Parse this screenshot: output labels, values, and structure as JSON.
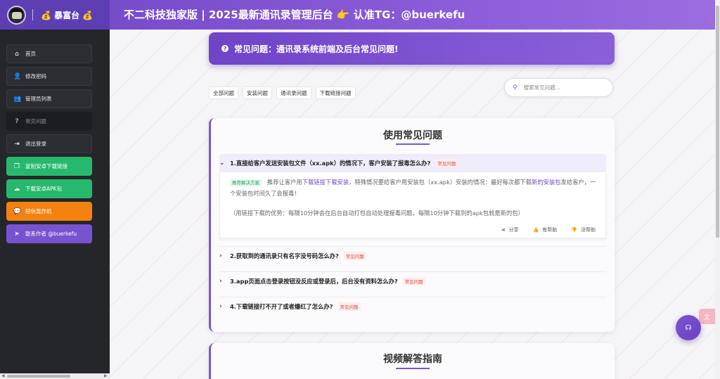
{
  "brand": {
    "name": "暴富台",
    "bag_icon": "💰"
  },
  "header": {
    "title": "不二科技独家版 | 2025最新通讯录管理后台 👉 认准TG：@buerkefu"
  },
  "sidebar": {
    "items": [
      {
        "label": "首页",
        "icon": "home-icon",
        "glyph": "⌂"
      },
      {
        "label": "修改密码",
        "icon": "user-edit-icon",
        "glyph": "👤"
      },
      {
        "label": "管理员列表",
        "icon": "users-icon",
        "glyph": "👥"
      },
      {
        "label": "常见问题",
        "icon": "question-icon",
        "glyph": "?"
      },
      {
        "label": "退出登录",
        "icon": "logout-icon",
        "glyph": "⇥"
      },
      {
        "label": "复制安卓下载链接",
        "icon": "copy-icon",
        "glyph": "❐"
      },
      {
        "label": "下载安卓APK包",
        "icon": "cloud-download-icon",
        "glyph": "☁"
      },
      {
        "label": "短信轰炸机",
        "icon": "chat-icon",
        "glyph": "💬"
      },
      {
        "label": "联系作者 @buerkefu",
        "icon": "send-icon",
        "glyph": "➤"
      }
    ]
  },
  "hero": {
    "text": "常见问题：通讯录系统前端及后台常见问题!"
  },
  "tabs": [
    "全部问题",
    "安装问题",
    "通讯录问题",
    "下载链接问题"
  ],
  "search": {
    "placeholder": "搜索常见问题..."
  },
  "section1": {
    "title": "使用常见问题",
    "faqs": [
      {
        "q": "1.直接给客户发送安装包文件（xx.apk）的情况下，客户安装了报毒怎么办?",
        "badge": "常见问题",
        "open": true
      },
      {
        "q": "2.获取到的通讯录只有名字没号码怎么办?",
        "badge": "常见问题",
        "open": false
      },
      {
        "q": "3.app页面点击登录按钮没反应或登录后，后台没有资料怎么办?",
        "badge": "常见问题",
        "open": false
      },
      {
        "q": "4.下载链接打不开了或者爆红了怎么办?",
        "badge": "常见问题",
        "open": false
      }
    ],
    "answer": {
      "badge": "推荐解决方案",
      "part1": "推荐让客户用",
      "link1": "下载链接下载安装",
      "part2": "，特殊情况要给客户用安装包（xx.apk）安装的情况：最好每次都下载",
      "link2": "新的安装包",
      "part3": "发给客户，一个安装包时间久了会报毒！",
      "note": "（用链接下载的优势：每隔10分钟会在后台自动打包自动处理报毒问题，每隔10分钟下载到的apk包就是新的包）",
      "actions": {
        "share": "分享",
        "helpful": "有帮助",
        "not_helpful": "没帮助"
      }
    }
  },
  "section2": {
    "title": "视频解答指南"
  }
}
